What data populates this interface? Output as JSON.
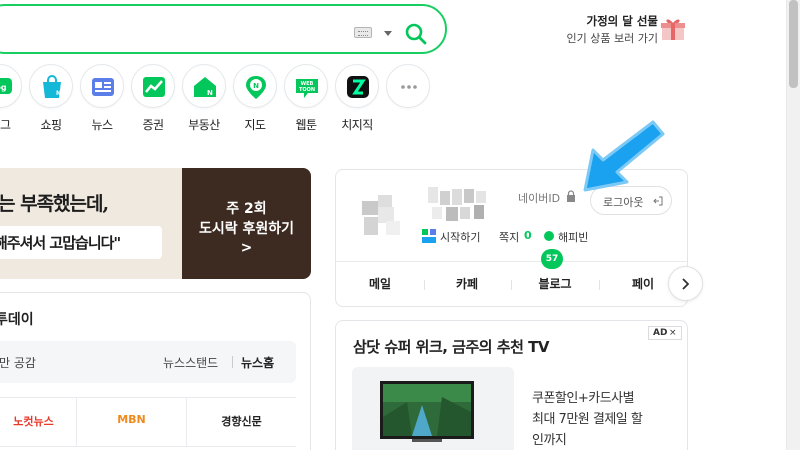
{
  "search": {
    "keyboard_icon": "keyboard-icon",
    "search_icon": "magnifier-icon"
  },
  "promo": {
    "title": "가정의 달 선물",
    "subtitle": "인기 상품 보러 가기",
    "icon": "gift-box-icon"
  },
  "shortcuts": [
    {
      "label": "블로그",
      "display": "로그",
      "icon": "blog-icon",
      "color": "#03c75a"
    },
    {
      "label": "쇼핑",
      "icon": "shopping-bag-icon",
      "color": "#16b8d8"
    },
    {
      "label": "뉴스",
      "icon": "news-icon",
      "color": "#5b7ee8"
    },
    {
      "label": "증권",
      "icon": "stock-chart-icon",
      "color": "#03c75a"
    },
    {
      "label": "부동산",
      "icon": "house-icon",
      "color": "#03c75a"
    },
    {
      "label": "지도",
      "icon": "map-pin-icon",
      "color": "#03c75a"
    },
    {
      "label": "웹툰",
      "icon": "webtoon-icon",
      "color": "#03c75a"
    },
    {
      "label": "치지직",
      "icon": "chzzk-icon",
      "color": "#111111"
    },
    {
      "label": "",
      "icon": "more-icon",
      "color": "#999999"
    }
  ],
  "banner": {
    "line1": "는 부족했는데,",
    "line2": "해주셔서 고맙습니다\"",
    "right_line1": "주 2회",
    "right_line2": "도시락 후원하기",
    "arrow": ">"
  },
  "news": {
    "title": "투데이",
    "bar_left": "만 공감",
    "newsstand": "뉴스스탠드",
    "news_home": "뉴스홈",
    "press": [
      {
        "name": "노컷뉴스",
        "color": "#e8392b"
      },
      {
        "name": "MBN",
        "color": "#f08a1e"
      },
      {
        "name": "경향신문",
        "color": "#222222"
      }
    ]
  },
  "login": {
    "naver_id": "네이버ID",
    "logout": "로그아웃",
    "start": "시작하기",
    "note": "쪽지",
    "note_count": "0",
    "happybean": "해피빈",
    "badge": "57",
    "tabs": [
      "메일",
      "카페",
      "블로그",
      "페이"
    ]
  },
  "ad": {
    "badge": "AD",
    "close": "×",
    "title": "삼닷 슈퍼 위크, 금주의 추천 TV",
    "line1": "쿠폰할인+카드사별",
    "line2": "최대 7만원 결제일 할",
    "line3": "인까지"
  },
  "colors": {
    "naver_green": "#03c75a",
    "search_border": "#19ce60",
    "annotation_arrow": "#1aa1f0"
  }
}
